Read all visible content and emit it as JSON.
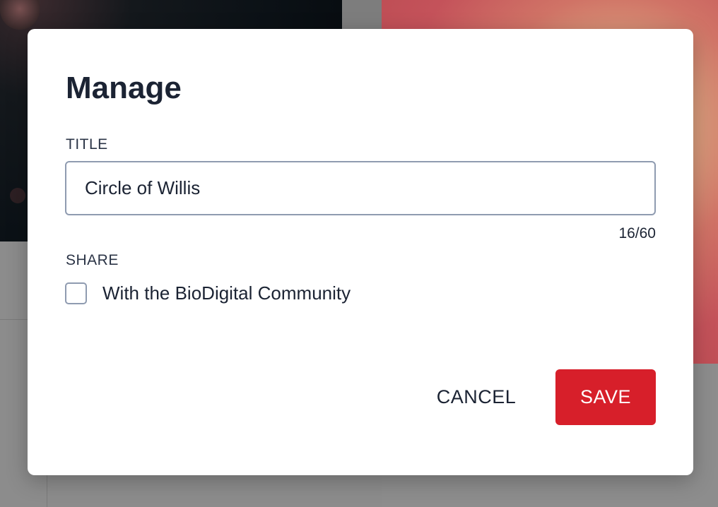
{
  "dialog": {
    "title": "Manage",
    "title_field": {
      "label": "TITLE",
      "value": "Circle of Willis",
      "char_count": "16/60"
    },
    "share": {
      "label": "SHARE",
      "option_label": "With the BioDigital Community",
      "checked": false
    },
    "buttons": {
      "cancel_label": "CANCEL",
      "save_label": "SAVE"
    }
  },
  "colors": {
    "save_button": "#d71f2a",
    "text": "#1b2333",
    "input_border": "#8f9bb0"
  }
}
